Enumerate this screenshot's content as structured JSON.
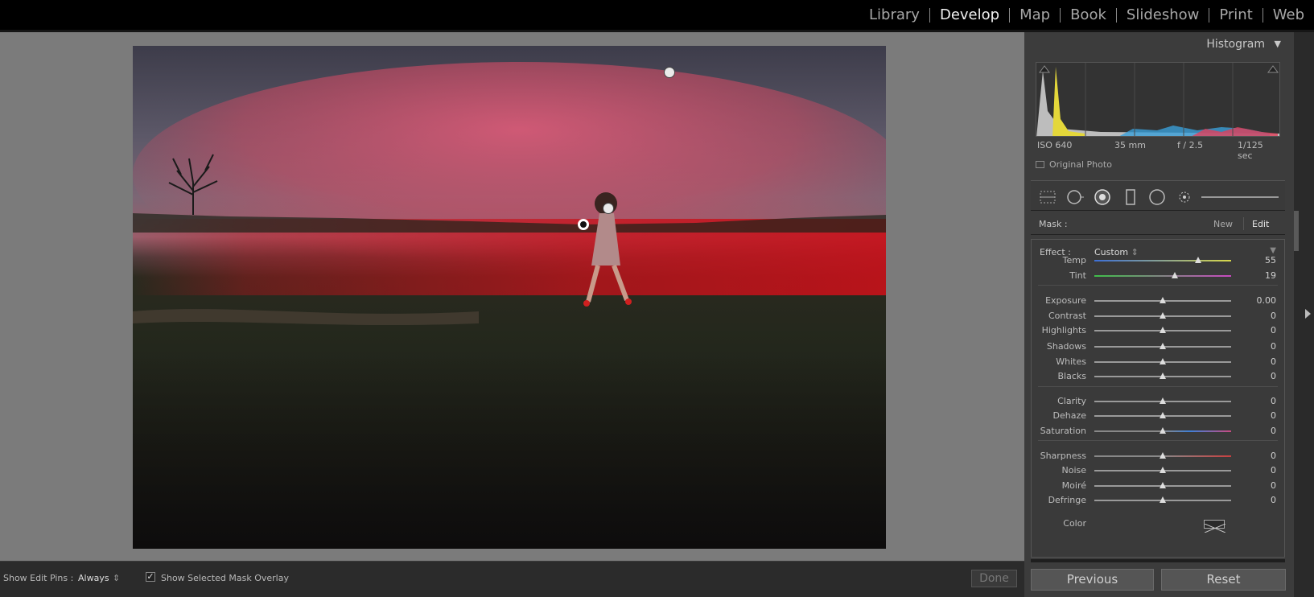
{
  "top_nav": {
    "modules": [
      "Library",
      "Develop",
      "Map",
      "Book",
      "Slideshow",
      "Print",
      "Web"
    ],
    "active": "Develop"
  },
  "toolbar": {
    "show_edit_pins_label": "Show Edit Pins :",
    "show_edit_pins_value": "Always",
    "show_mask_overlay_label": "Show Selected Mask Overlay",
    "show_mask_overlay_checked": true,
    "done_label": "Done"
  },
  "histogram": {
    "title": "Histogram",
    "iso": "ISO 640",
    "focal": "35 mm",
    "aperture": "f / 2.5",
    "shutter": "1/125 sec",
    "original_photo_label": "Original Photo"
  },
  "mask": {
    "label": "Mask :",
    "new_label": "New",
    "edit_label": "Edit"
  },
  "effect": {
    "label": "Effect :",
    "value": "Custom"
  },
  "sliders": [
    {
      "name": "Temp",
      "value": "55",
      "level": 0.76,
      "track": "temp"
    },
    {
      "name": "Tint",
      "value": "19",
      "level": 0.59,
      "track": "tint"
    },
    {
      "name": "Exposure",
      "value": "0.00",
      "level": 0.5,
      "track": "plain"
    },
    {
      "name": "Contrast",
      "value": "0",
      "level": 0.5,
      "track": "plain"
    },
    {
      "name": "Highlights",
      "value": "0",
      "level": 0.5,
      "track": "plain"
    },
    {
      "name": "Shadows",
      "value": "0",
      "level": 0.5,
      "track": "plain"
    },
    {
      "name": "Whites",
      "value": "0",
      "level": 0.5,
      "track": "plain"
    },
    {
      "name": "Blacks",
      "value": "0",
      "level": 0.5,
      "track": "plain"
    },
    {
      "name": "Clarity",
      "value": "0",
      "level": 0.5,
      "track": "plain"
    },
    {
      "name": "Dehaze",
      "value": "0",
      "level": 0.5,
      "track": "plain"
    },
    {
      "name": "Saturation",
      "value": "0",
      "level": 0.5,
      "track": "sat"
    },
    {
      "name": "Sharpness",
      "value": "0",
      "level": 0.5,
      "track": "sharp"
    },
    {
      "name": "Noise",
      "value": "0",
      "level": 0.5,
      "track": "plain"
    },
    {
      "name": "Moiré",
      "value": "0",
      "level": 0.5,
      "track": "plain"
    },
    {
      "name": "Defringe",
      "value": "0",
      "level": 0.5,
      "track": "plain"
    }
  ],
  "color_label": "Color",
  "buttons": {
    "previous": "Previous",
    "reset": "Reset"
  },
  "colors": {
    "mask_overlay": "#e8202a",
    "temp_track": [
      "#3d6fd6",
      "#d8d84a"
    ],
    "tint_track": [
      "#3fbf4a",
      "#c84ac0"
    ]
  },
  "icons": [
    "graduated-filter-icon",
    "spot-removal-icon",
    "radial-filter-icon",
    "crop-icon",
    "red-eye-icon",
    "adjustment-brush-icon"
  ]
}
